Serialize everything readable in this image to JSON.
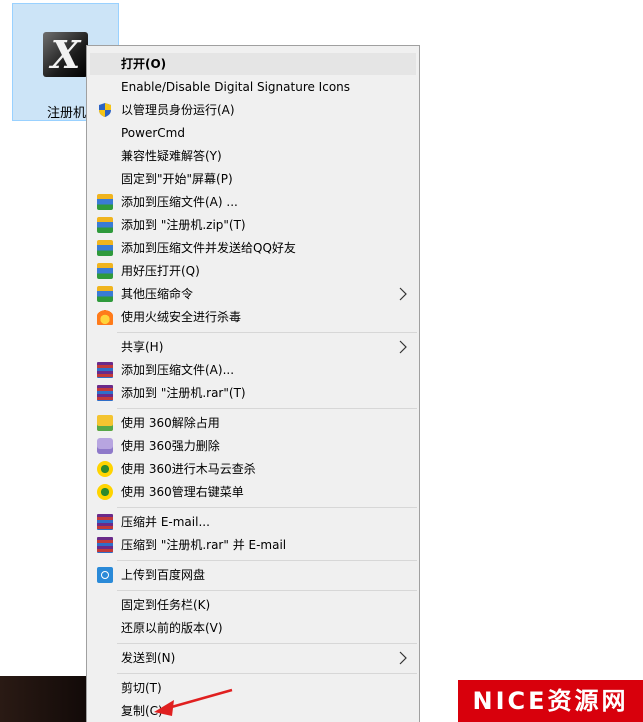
{
  "desktop_icon": {
    "label": "注册机",
    "glyph": "X"
  },
  "context_menu": {
    "items": [
      {
        "label": "打开(O)",
        "icon": null,
        "bold": true,
        "highlighted": true,
        "submenu": false
      },
      {
        "label": "Enable/Disable Digital Signature Icons",
        "icon": null,
        "submenu": false
      },
      {
        "label": "以管理员身份运行(A)",
        "icon": "uac-shield-icon",
        "submenu": false
      },
      {
        "label": "PowerCmd",
        "icon": null,
        "submenu": false
      },
      {
        "label": "兼容性疑难解答(Y)",
        "icon": null,
        "submenu": false
      },
      {
        "label": "固定到\"开始\"屏幕(P)",
        "icon": null,
        "submenu": false
      },
      {
        "label": "添加到压缩文件(A) ...",
        "icon": "compress-icon",
        "submenu": false
      },
      {
        "label": "添加到 \"注册机.zip\"(T)",
        "icon": "compress-icon",
        "submenu": false
      },
      {
        "label": "添加到压缩文件并发送给QQ好友",
        "icon": "compress-icon",
        "submenu": false
      },
      {
        "label": "用好压打开(Q)",
        "icon": "compress-icon",
        "submenu": false
      },
      {
        "label": "其他压缩命令",
        "icon": "compress-icon",
        "submenu": true
      },
      {
        "label": "使用火绒安全进行杀毒",
        "icon": "fire-icon",
        "submenu": false
      },
      {
        "label": "共享(H)",
        "icon": null,
        "submenu": true
      },
      {
        "label": "添加到压缩文件(A)...",
        "icon": "winrar-icon",
        "submenu": false
      },
      {
        "label": "添加到 \"注册机.rar\"(T)",
        "icon": "winrar-icon",
        "submenu": false
      },
      {
        "label": "使用 360解除占用",
        "icon": "folder-360-icon",
        "submenu": false
      },
      {
        "label": "使用 360强力删除",
        "icon": "shredder-360-icon",
        "submenu": false
      },
      {
        "label": "使用 360进行木马云查杀",
        "icon": "security-360-icon",
        "submenu": false
      },
      {
        "label": "使用 360管理右键菜单",
        "icon": "security-360-icon",
        "submenu": false
      },
      {
        "label": "压缩并 E-mail...",
        "icon": "winrar-icon",
        "submenu": false
      },
      {
        "label": "压缩到 \"注册机.rar\" 并 E-mail",
        "icon": "winrar-icon",
        "submenu": false
      },
      {
        "label": "上传到百度网盘",
        "icon": "baidu-netdisk-icon",
        "submenu": false
      },
      {
        "label": "固定到任务栏(K)",
        "icon": null,
        "submenu": false
      },
      {
        "label": "还原以前的版本(V)",
        "icon": null,
        "submenu": false
      },
      {
        "label": "发送到(N)",
        "icon": null,
        "submenu": true
      },
      {
        "label": "剪切(T)",
        "icon": null,
        "submenu": false
      },
      {
        "label": "复制(C)",
        "icon": null,
        "submenu": false
      }
    ]
  },
  "watermark": {
    "text": "NICE资源网"
  },
  "colors": {
    "menu_bg": "#f0f0f0",
    "selection": "#cce4f7",
    "highlight": "#e5e5e5",
    "watermark_bg": "#d8000c",
    "annotation_arrow": "#e02020"
  }
}
